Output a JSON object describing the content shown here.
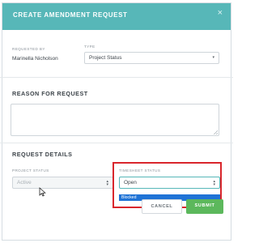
{
  "dialog": {
    "title": "CREATE AMENDMENT REQUEST",
    "close_icon": "×"
  },
  "requested_by": {
    "label": "REQUESTED BY",
    "value": "Marinella Nicholson"
  },
  "type": {
    "label": "TYPE",
    "value": "Project Status"
  },
  "reason": {
    "title": "REASON FOR REQUEST",
    "value": ""
  },
  "details": {
    "title": "REQUEST DETAILS",
    "project_status": {
      "label": "PROJECT STATUS",
      "value": "Active",
      "disabled": true
    },
    "timesheet_status": {
      "label": "TIMESHEET STATUS",
      "value": "Open",
      "highlighted_option": "Blocked"
    }
  },
  "buttons": {
    "cancel": "CANCEL",
    "submit": "SUBMIT"
  },
  "colors": {
    "header": "#57b7b8",
    "submit": "#5cb85c",
    "highlight_border": "#d9262c",
    "dropdown_highlight": "#1f73d6"
  },
  "icons": {
    "close": "close-icon",
    "select_caret": "chevron-updown-icon",
    "cursor": "mouse-pointer-icon",
    "resize": "resize-grip-icon"
  }
}
